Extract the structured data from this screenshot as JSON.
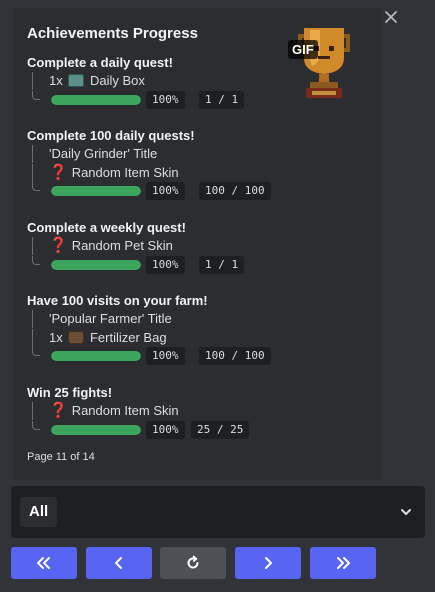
{
  "embed": {
    "title": "Achievements Progress",
    "gif_badge": "GIF",
    "thumbnail_icon": "trophy-icon",
    "footer": "Page 11 of 14",
    "accent_color": "#3ba55d",
    "achievements": [
      {
        "title": "Complete a daily quest!",
        "rewards": [
          {
            "prefix": "1x",
            "icon": "daily-box-icon",
            "label": "Daily Box"
          }
        ],
        "progress": 1.0,
        "percent": "100%",
        "count": "1 / 1"
      },
      {
        "title": "Complete 100 daily quests!",
        "rewards": [
          {
            "prefix": "",
            "icon": "",
            "label": "'Daily Grinder' Title"
          },
          {
            "prefix": "",
            "icon": "question-mark-icon",
            "label": "Random Item Skin"
          }
        ],
        "progress": 1.0,
        "percent": "100%",
        "count": "100 / 100"
      },
      {
        "title": "Complete a weekly quest!",
        "rewards": [
          {
            "prefix": "",
            "icon": "question-mark-icon",
            "label": "Random Pet Skin"
          }
        ],
        "progress": 1.0,
        "percent": "100%",
        "count": "1 / 1"
      },
      {
        "title": "Have 100 visits on your farm!",
        "rewards": [
          {
            "prefix": "",
            "icon": "",
            "label": "'Popular Farmer' Title"
          },
          {
            "prefix": "1x",
            "icon": "fertilizer-bag-icon",
            "label": "Fertilizer Bag"
          }
        ],
        "progress": 1.0,
        "percent": "100%",
        "count": "100 / 100"
      },
      {
        "title": "Win 25 fights!",
        "rewards": [
          {
            "prefix": "",
            "icon": "question-mark-icon",
            "label": "Random Item Skin"
          }
        ],
        "progress": 1.0,
        "percent": "100%",
        "count": "25 / 25"
      }
    ]
  },
  "select": {
    "value": "All",
    "caret_icon": "chevron-down-icon"
  },
  "nav_buttons": [
    {
      "icon": "double-chevron-left-icon"
    },
    {
      "icon": "chevron-left-icon"
    },
    {
      "icon": "refresh-icon"
    },
    {
      "icon": "chevron-right-icon"
    },
    {
      "icon": "double-chevron-right-icon"
    }
  ],
  "close_icon": "close-icon",
  "colors": {
    "background": "#313338",
    "embed": "#2b2d31",
    "button_primary": "#5865f2",
    "button_secondary": "#4e5058"
  }
}
